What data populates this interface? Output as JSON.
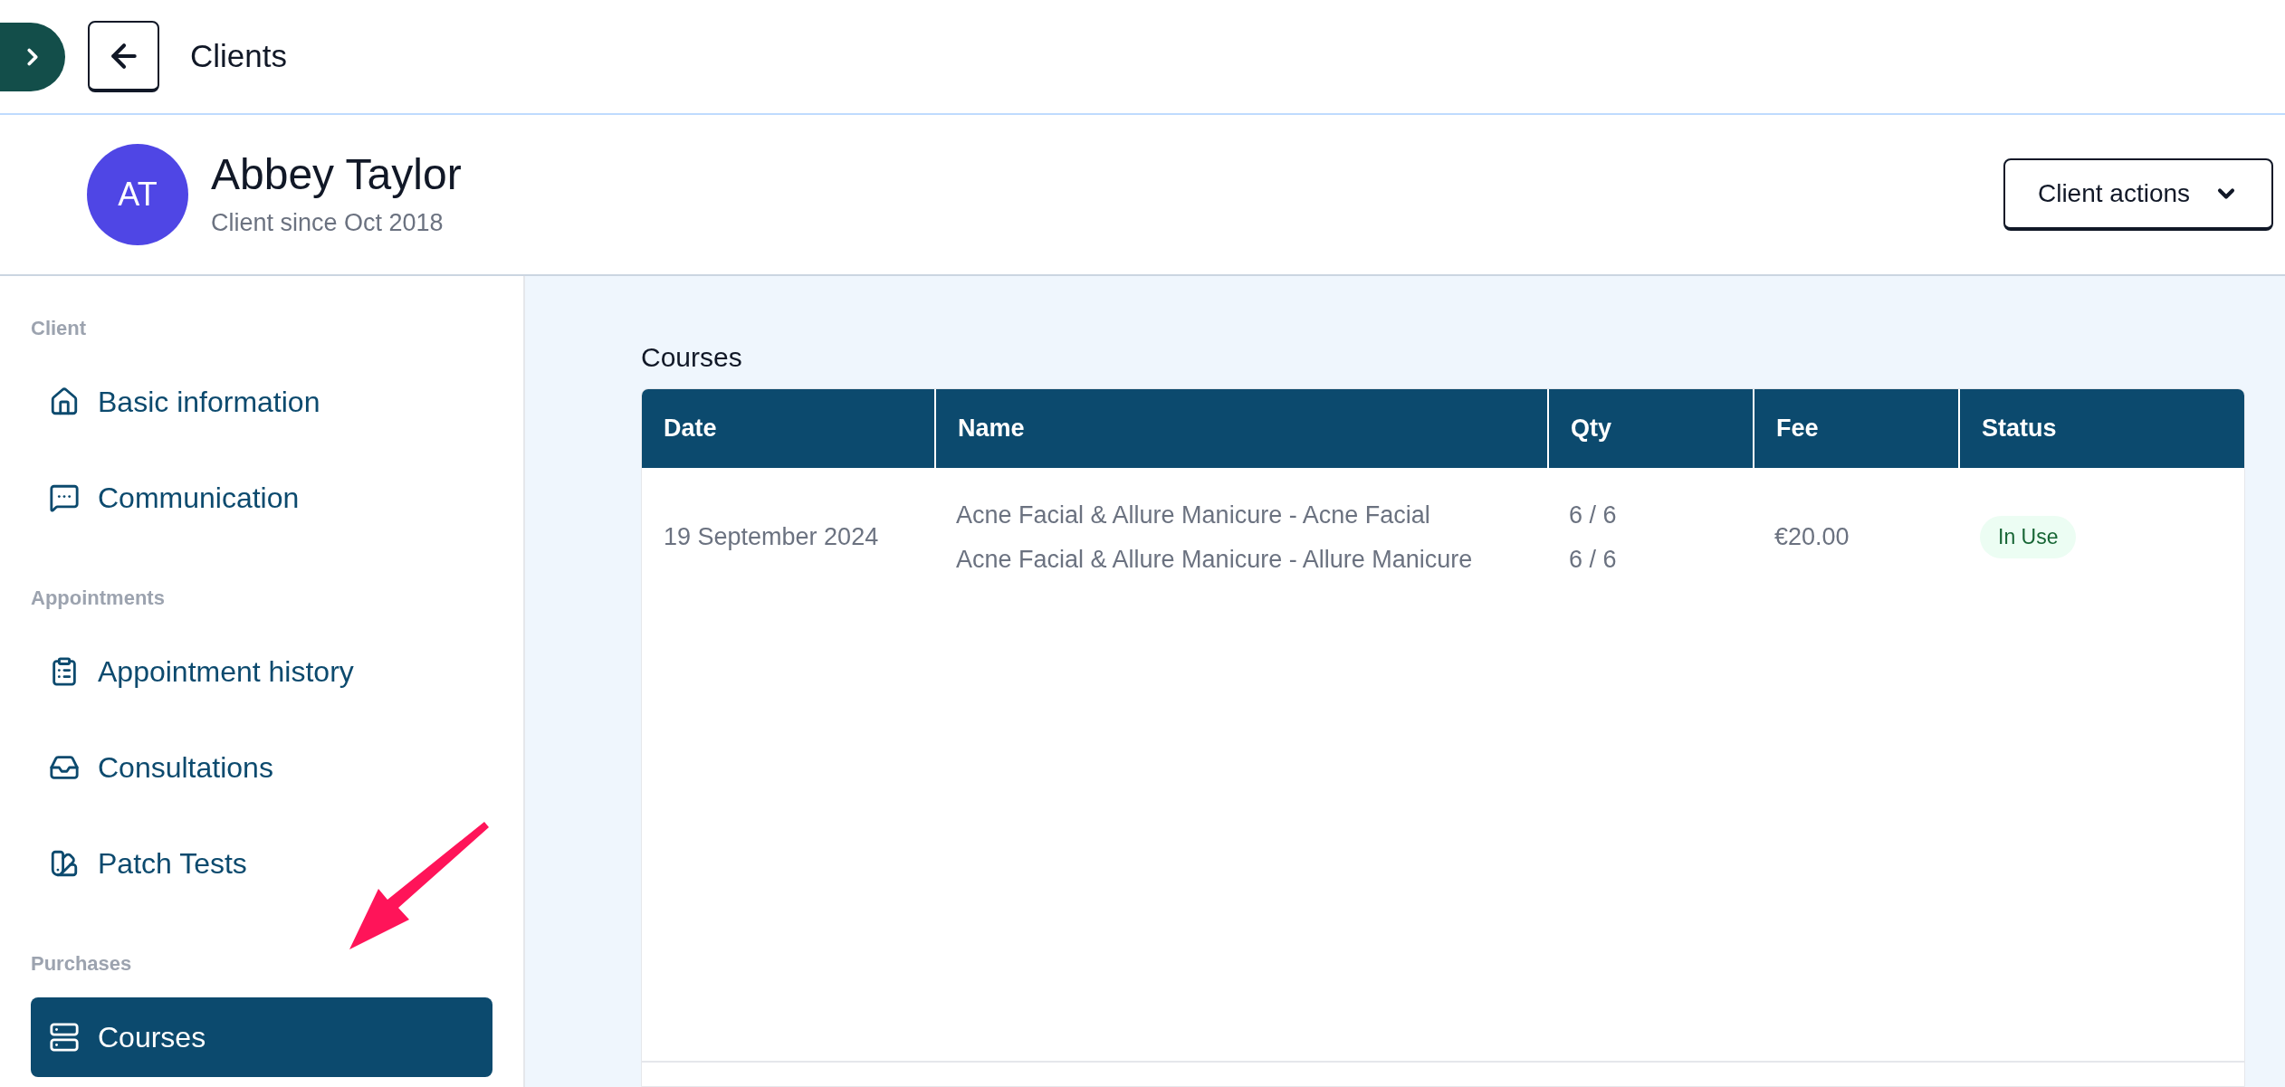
{
  "top_bar": {
    "title": "Clients"
  },
  "client": {
    "initials": "AT",
    "name": "Abbey Taylor",
    "since": "Client since Oct 2018",
    "actions_button": "Client actions"
  },
  "sidebar": {
    "sections": [
      {
        "label": "Client",
        "items": [
          {
            "label": "Basic information",
            "selected": false
          },
          {
            "label": "Communication",
            "selected": false
          }
        ]
      },
      {
        "label": "Appointments",
        "items": [
          {
            "label": "Appointment history",
            "selected": false
          },
          {
            "label": "Consultations",
            "selected": false
          },
          {
            "label": "Patch Tests",
            "selected": false
          }
        ]
      },
      {
        "label": "Purchases",
        "items": [
          {
            "label": "Courses",
            "selected": true
          }
        ]
      }
    ]
  },
  "courses": {
    "title": "Courses",
    "columns": [
      "Date",
      "Name",
      "Qty",
      "Fee",
      "Status"
    ],
    "rows": [
      {
        "date": "19 September 2024",
        "names": [
          "Acne Facial & Allure Manicure - Acne Facial",
          "Acne Facial & Allure Manicure - Allure Manicure"
        ],
        "qtys": [
          "6 / 6",
          "6 / 6"
        ],
        "fee": "€20.00",
        "status": "In Use"
      }
    ]
  }
}
